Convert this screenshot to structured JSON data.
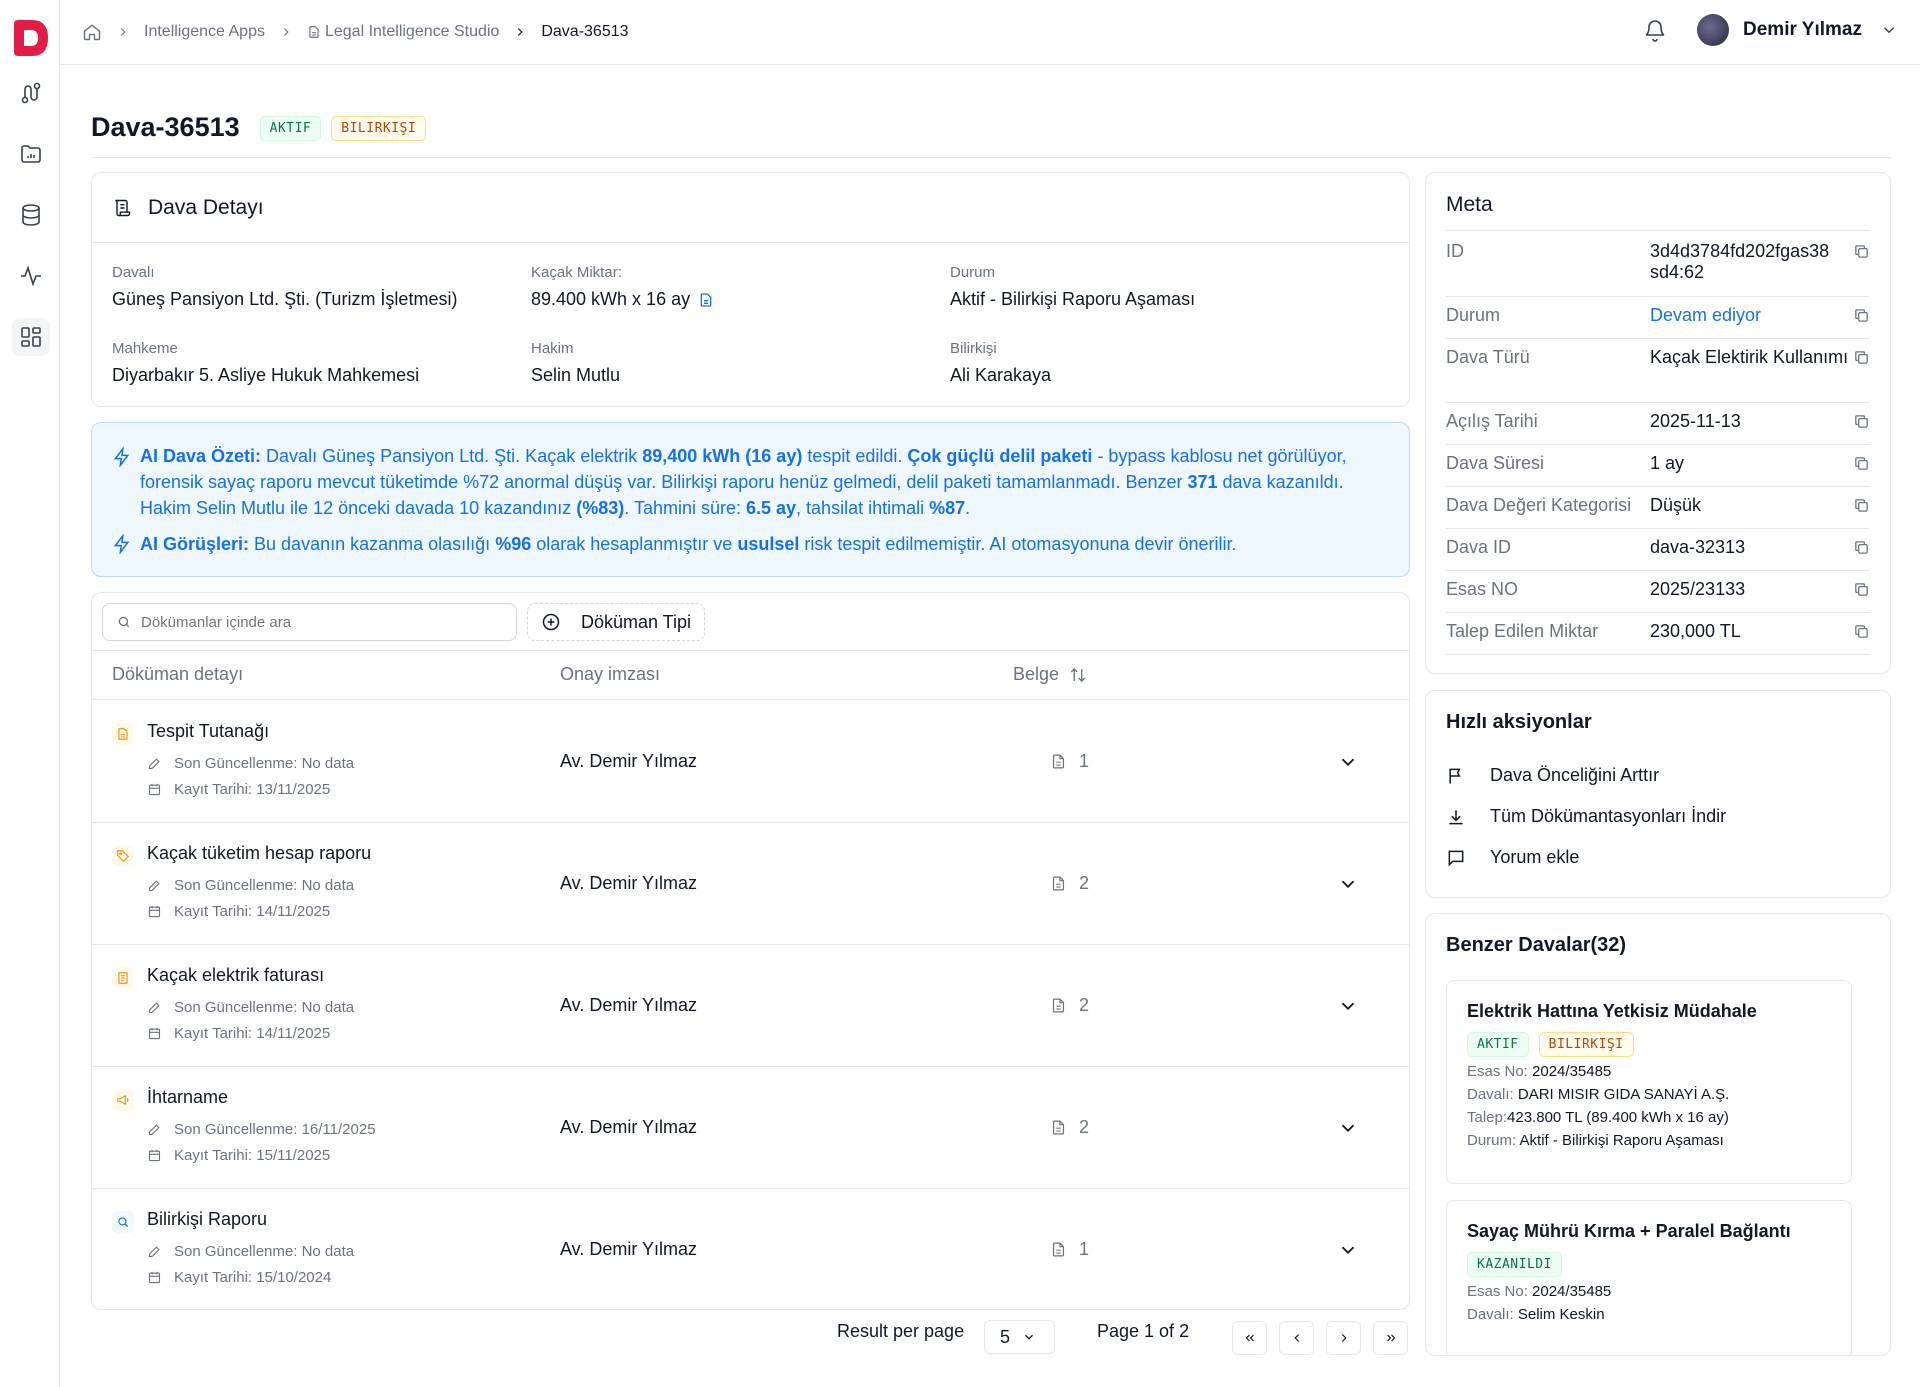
{
  "app": {
    "brand": "D",
    "accent": "#e11d48"
  },
  "breadcrumb": {
    "items": [
      "Intelligence Apps",
      "Legal Intelligence Studio",
      "Dava-36513"
    ]
  },
  "user": {
    "name": "Demir Yılmaz"
  },
  "page": {
    "title": "Dava-36513",
    "badges": [
      "AKTIF",
      "BILIRKIŞI"
    ]
  },
  "detail": {
    "heading": "Dava Detayı",
    "fields": [
      {
        "label": "Davalı",
        "value": "Güneş Pansiyon Ltd. Şti. (Turizm İşletmesi)"
      },
      {
        "label": "Kaçak Miktar:",
        "value": "89.400 kWh x 16 ay"
      },
      {
        "label": "Durum",
        "value": "Aktif - Bilirkişi Raporu Aşaması"
      },
      {
        "label": "Mahkeme",
        "value": "Diyarbakır 5. Asliye Hukuk Mahkemesi"
      },
      {
        "label": "Hakim",
        "value": "Selin Mutlu"
      },
      {
        "label": "Bilirkişi",
        "value": "Ali Karakaya"
      }
    ]
  },
  "ai": {
    "summary_label": "AI Dava Özeti:",
    "summary_parts": [
      " Davalı Güneş Pansiyon Ltd. Şti. Kaçak elektrik ",
      "89,400 kWh (16 ay)",
      " tespit edildi. ",
      "Çok güçlü delil paketi",
      " - bypass kablosu net görülüyor, forensik sayaç raporu mevcut tüketimde %72 anormal düşüş var. Bilirkişi raporu henüz gelmedi, delil  paketi tamamlanmadı. Benzer ",
      "371",
      " dava kazanıldı. Hakim Selin Mutlu ile 12 önceki davada 10 kazandınız ",
      "(%83)",
      ". Tahmini süre: ",
      "6.5 ay",
      ",  tahsilat ihtimali ",
      "%87",
      "."
    ],
    "opinion_label": "AI Görüşleri:",
    "opinion_parts": [
      " Bu davanın kazanma olasılığı ",
      "%96",
      " olarak hesaplanmıştır ve ",
      "usulsel",
      " risk tespit edilmemiştir. AI otomasyonuna devir önerilir."
    ]
  },
  "docs": {
    "search_placeholder": "Dökümanlar içinde ara",
    "type_button": "Döküman Tipi",
    "columns": [
      "Döküman detayı",
      "Onay imzası",
      "Belge"
    ],
    "rows": [
      {
        "name": "Tespit Tutanağı",
        "updated": "Son Güncellenme: No data",
        "created": "Kayıt Tarihi: 13/11/2025",
        "signer": "Av. Demir Yılmaz",
        "count": "1",
        "icon": "document-icon",
        "icon_color": "#f79009"
      },
      {
        "name": "Kaçak tüketim hesap raporu",
        "updated": "Son Güncellenme: No data",
        "created": "Kayıt Tarihi: 14/11/2025",
        "signer": "Av. Demir Yılmaz",
        "count": "2",
        "icon": "tag-icon",
        "icon_color": "#f79009"
      },
      {
        "name": "Kaçak elektrik faturası",
        "updated": "Son Güncellenme: No data",
        "created": "Kayıt Tarihi: 14/11/2025",
        "signer": "Av. Demir Yılmaz",
        "count": "2",
        "icon": "invoice-icon",
        "icon_color": "#f79009"
      },
      {
        "name": "İhtarname",
        "updated": "Son Güncellenme: 16/11/2025",
        "created": "Kayıt Tarihi: 15/11/2025",
        "signer": "Av. Demir Yılmaz",
        "count": "2",
        "icon": "megaphone-icon",
        "icon_color": "#f79009"
      },
      {
        "name": "Bilirkişi Raporu",
        "updated": "Son Güncellenme: No data",
        "created": "Kayıt Tarihi: 15/10/2024",
        "signer": "Av. Demir Yılmaz",
        "count": "1",
        "icon": "search-icon",
        "icon_color": "#1570ef"
      }
    ]
  },
  "pagination": {
    "label": "Result per page",
    "per_page": "5",
    "page_text": "Page 1 of 2"
  },
  "meta": {
    "heading": "Meta",
    "rows": [
      {
        "key": "ID",
        "value": "3d4d3784fd202fgas38 sd4:62"
      },
      {
        "key": "Durum",
        "value": "Devam ediyor",
        "link": true
      },
      {
        "key": "Dava Türü",
        "value": "Kaçak Elektirik Kullanımı"
      },
      {
        "key": "Açılış Tarihi",
        "value": "2025-11-13"
      },
      {
        "key": "Dava Süresi",
        "value": "1 ay"
      },
      {
        "key": "Dava Değeri Kategorisi",
        "value": "Düşük"
      },
      {
        "key": "Dava ID",
        "value": "dava-32313"
      },
      {
        "key": "Esas NO",
        "value": "2025/23133"
      },
      {
        "key": "Talep Edilen Miktar",
        "value": "230,000 TL"
      }
    ]
  },
  "quick_actions": {
    "heading": "Hızlı aksiyonlar",
    "items": [
      "Dava Önceliğini Arttır",
      "Tüm Dökümantasyonları İndir",
      "Yorum ekle"
    ]
  },
  "similar": {
    "heading": "Benzer Davalar(32)",
    "cases": [
      {
        "title": "Elektrik Hattına Yetkisiz Müdahale",
        "badges": [
          "AKTIF",
          "BILIRKIŞI"
        ],
        "esas_label": "Esas No: ",
        "esas": "2024/35485",
        "davali_label": "Davalı: ",
        "davali": "DARI MISIR GIDA SANAYİ A.Ş.",
        "talep_label": "Talep:",
        "talep": "423.800 TL (89.400 kWh x 16 ay)",
        "durum_label": "Durum: ",
        "durum": "Aktif - Bilirkişi Raporu Aşaması"
      },
      {
        "title": "Sayaç Mührü Kırma + Paralel Bağlantı",
        "badges": [
          "KAZANILDI"
        ],
        "esas_label": "Esas No: ",
        "esas": "2024/35485",
        "davali_label": "Davalı: ",
        "davali": " Selim Keskin"
      }
    ]
  }
}
